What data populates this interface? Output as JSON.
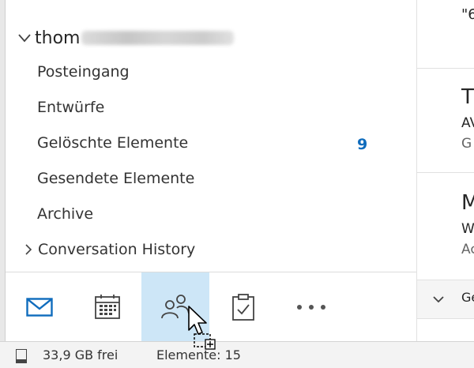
{
  "account": {
    "name_prefix": "thom"
  },
  "folders": [
    {
      "label": "Posteingang"
    },
    {
      "label": "Entwürfe"
    },
    {
      "label": "Gelöschte Elemente",
      "count": "9"
    },
    {
      "label": "Gesendete Elemente"
    },
    {
      "label": "Archive"
    },
    {
      "label": "Conversation History"
    }
  ],
  "nav": [
    {
      "icon": "mail-icon"
    },
    {
      "icon": "calendar-icon"
    },
    {
      "icon": "people-icon",
      "active": true
    },
    {
      "icon": "tasks-icon"
    },
    {
      "icon": "more-icon"
    }
  ],
  "status": {
    "storage": "33,9 GB frei",
    "elements": "Elemente: 15"
  },
  "messages": {
    "top_fragment": "\"6",
    "m1": {
      "initial": "T",
      "line2": "AV",
      "line3": "G"
    },
    "m2": {
      "initial": "M",
      "line2": "W",
      "line3": "Ac"
    },
    "group_label": "Ge"
  },
  "colors": {
    "accent": "#0f6cbd",
    "nav_active_bg": "#cde6f7",
    "mail_icon": "#0f6cbd"
  }
}
